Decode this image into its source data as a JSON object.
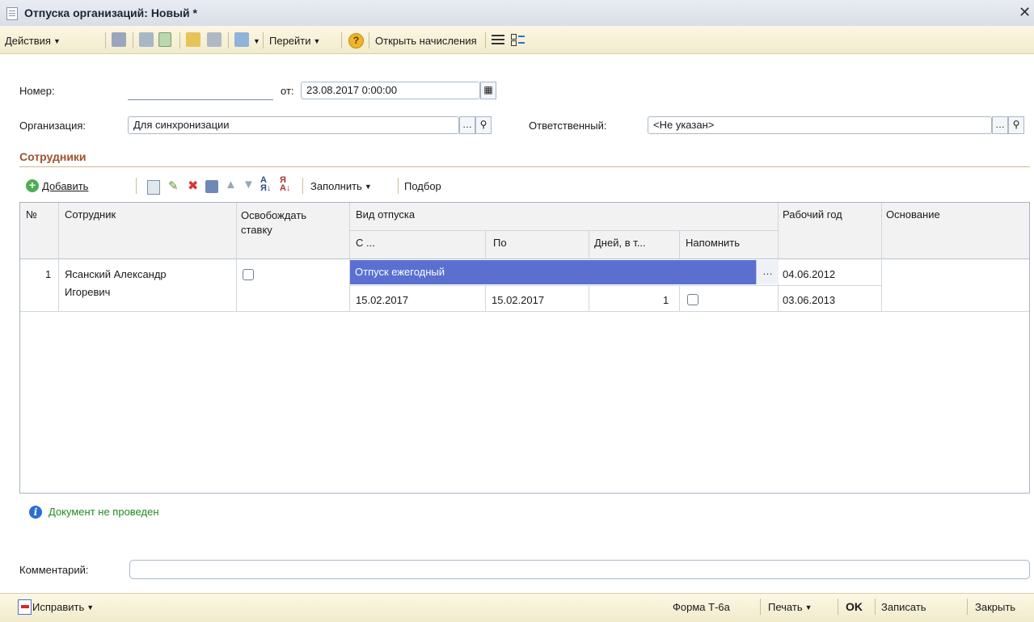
{
  "window": {
    "title": "Отпуска организаций: Новый *"
  },
  "toolbar": {
    "actions_label": "Действия",
    "goto_label": "Перейти",
    "open_accruals_label": "Открыть начисления"
  },
  "form": {
    "number_label": "Номер:",
    "number_value": "",
    "date_label": "от:",
    "date_value": "23.08.2017  0:00:00",
    "organization_label": "Организация:",
    "organization_value": "Для синхронизации",
    "responsible_label": "Ответственный:",
    "responsible_value": "<Не указан>"
  },
  "employees": {
    "section_title": "Сотрудники",
    "add_label": "Добавить",
    "fill_label": "Заполнить",
    "selection_label": "Подбор",
    "columns": {
      "num": "№",
      "employee": "Сотрудник",
      "release_rate": "Освобождать ставку",
      "vacation_type": "Вид отпуска",
      "from": "С ...",
      "to": "По",
      "days": "Дней, в т...",
      "remind": "Напомнить",
      "work_year": "Рабочий год",
      "basis": "Основание"
    },
    "rows": [
      {
        "num": "1",
        "employee_line1": "Ясанский Александр",
        "employee_line2": "Игоревич",
        "release_rate": false,
        "vacation_type": "Отпуск ежегодный",
        "from": "15.02.2017",
        "to": "15.02.2017",
        "days": "1",
        "remind": false,
        "work_year_start": "04.06.2012",
        "work_year_end": "03.06.2013",
        "basis": ""
      }
    ]
  },
  "status": {
    "info_text": "Документ не проведен"
  },
  "comment": {
    "label": "Комментарий:",
    "value": ""
  },
  "bottom": {
    "fix_label": "Исправить",
    "form_t6a_label": "Форма Т-6а",
    "print_label": "Печать",
    "ok_label": "OK",
    "save_label": "Записать",
    "close_label": "Закрыть"
  },
  "colors": {
    "toolbar_bg": "#f1ebcc",
    "section_title": "#a0522d",
    "selected_cell": "#5a6fcf",
    "info_text": "#228b22"
  }
}
